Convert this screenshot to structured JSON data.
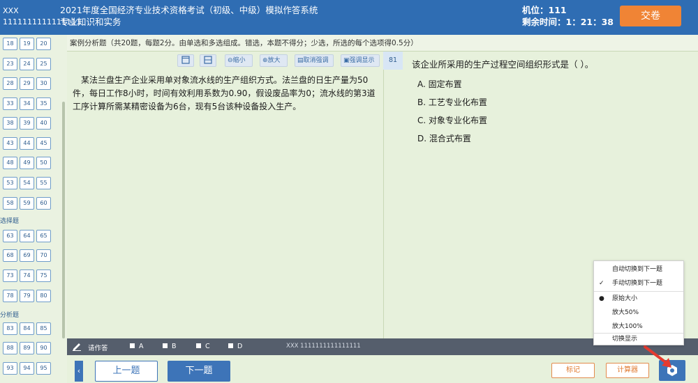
{
  "header": {
    "user_name": "XXX",
    "user_id": "1111111111111111",
    "exam_title": "2021年度全国经济专业技术资格考试（初级、中级）模拟作答系统",
    "subject": "专业知识和实务",
    "seat_label": "机位：111",
    "time_label": "剩余时间：1：21：38",
    "submit_label": "交卷"
  },
  "sidebar": {
    "rows": [
      [
        "18",
        "19",
        "20"
      ],
      [
        "23",
        "24",
        "25"
      ],
      [
        "28",
        "29",
        "30"
      ],
      [
        "33",
        "34",
        "35"
      ],
      [
        "38",
        "39",
        "40"
      ],
      [
        "43",
        "44",
        "45"
      ],
      [
        "48",
        "49",
        "50"
      ],
      [
        "53",
        "54",
        "55"
      ],
      [
        "58",
        "59",
        "60"
      ],
      [
        "63",
        "64",
        "65"
      ],
      [
        "68",
        "69",
        "70"
      ],
      [
        "73",
        "74",
        "75"
      ],
      [
        "78",
        "79",
        "80"
      ],
      [
        "83",
        "84",
        "85"
      ],
      [
        "88",
        "89",
        "90"
      ],
      [
        "93",
        "94",
        "95"
      ]
    ],
    "section_labels": [
      "选择题",
      "分析题"
    ]
  },
  "instruction": "案例分析题（共20题，每题2分。由单选和多选组成。错选，本题不得分；少选，所选的每个选项得0.5分）",
  "toolbar": {
    "zoom_out": "缩小",
    "zoom_in": "放大",
    "cancel_highlight": "取消强调",
    "highlight_show": "强调显示",
    "question_number": "81"
  },
  "material": "某法兰盘生产企业采用单对象流水线的生产组织方式。法兰盘的日生产量为50件，每日工作8小时，时间有效利用系数为0.90，假设废品率为0；流水线的第3道工序计算所需某精密设备为6台，现有5台该种设备投入生产。",
  "question": {
    "text": "该企业所采用的生产过程空间组织形式是（ ）。",
    "options": [
      "A. 固定布置",
      "B. 工艺专业化布置",
      "C. 对象专业化布置",
      "D. 混合式布置"
    ]
  },
  "answer_bar": {
    "label": "请作答",
    "choices": [
      "A",
      "B",
      "C",
      "D"
    ],
    "footer": "XXX 1111111111111111"
  },
  "nav": {
    "prev": "上一题",
    "next": "下一题",
    "mark": "标记",
    "calculator": "计算器"
  },
  "popup": {
    "items": [
      {
        "label": "自动切换到下一题",
        "mark": ""
      },
      {
        "label": "手动切换到下一题",
        "mark": "✓"
      },
      {
        "label": "原始大小",
        "mark": "●"
      },
      {
        "label": "放大50%",
        "mark": ""
      },
      {
        "label": "放大100%",
        "mark": ""
      },
      {
        "label": "切换显示",
        "mark": ""
      }
    ]
  },
  "colors": {
    "header_bg": "#2f6db3",
    "submit_bg": "#f08435",
    "content_bg": "#e7f1dc",
    "answer_bar_bg": "#555e6c",
    "primary_button": "#3d74b8",
    "accent_orange": "#e07a30",
    "arrow_red": "#e53a2f"
  }
}
